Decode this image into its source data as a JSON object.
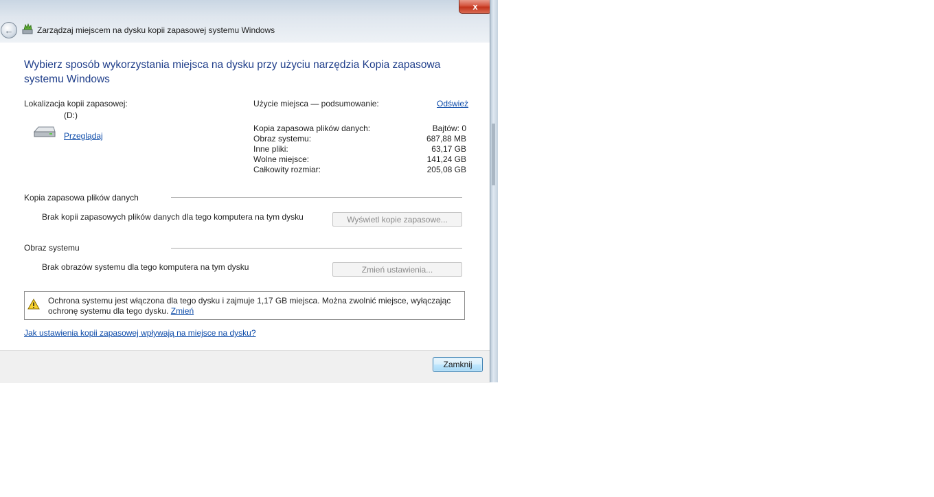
{
  "window": {
    "title": "Zarządzaj miejscem na dysku kopii zapasowej systemu Windows",
    "close_symbol": "x"
  },
  "heading": "Wybierz sposób wykorzystania miejsca na dysku przy użyciu narzędzia Kopia zapasowa systemu Windows",
  "location": {
    "label": "Lokalizacja kopii zapasowej:",
    "drive": "(D:)",
    "browse_link": "Przeglądaj"
  },
  "usage": {
    "title": "Użycie miejsca — podsumowanie:",
    "refresh_link": "Odśwież",
    "rows": [
      {
        "label": "Kopia zapasowa plików danych:",
        "value": "Bajtów: 0"
      },
      {
        "label": "Obraz systemu:",
        "value": "687,88 MB"
      },
      {
        "label": "Inne pliki:",
        "value": "63,17 GB"
      },
      {
        "label": "Wolne miejsce:",
        "value": "141,24 GB"
      },
      {
        "label": "Całkowity rozmiar:",
        "value": "205,08 GB"
      }
    ]
  },
  "data_backup": {
    "section_title": "Kopia zapasowa plików danych",
    "message": "Brak kopii zapasowych plików danych dla tego komputera na tym dysku",
    "button": "Wyświetl kopie zapasowe..."
  },
  "system_image": {
    "section_title": "Obraz systemu",
    "message": "Brak obrazów systemu dla tego komputera na tym dysku",
    "button": "Zmień ustawienia..."
  },
  "protection": {
    "text": "Ochrona systemu jest włączona dla tego dysku i zajmuje 1,17 GB miejsca. Można zwolnić miejsce, wyłączając ochronę systemu dla tego dysku.",
    "change_link": "Zmień"
  },
  "help_link": "Jak ustawienia kopii zapasowej wpływają na miejsce na dysku?",
  "footer": {
    "close_button": "Zamknij"
  },
  "colors": {
    "heading": "#1f3e8a",
    "link": "#0a49a8",
    "close_red": "#c2341c"
  }
}
